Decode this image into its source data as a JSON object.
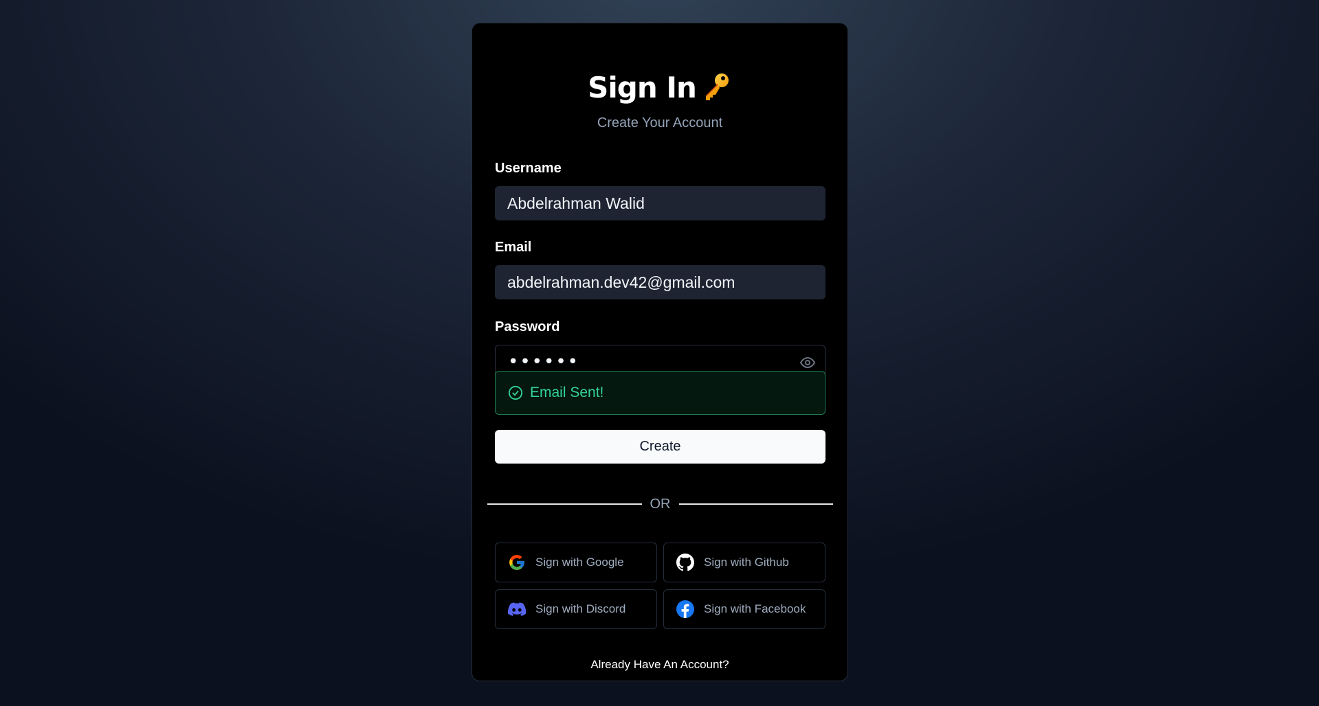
{
  "header": {
    "title": "Sign In",
    "subtitle": "Create Your Account"
  },
  "form": {
    "username": {
      "label": "Username",
      "value": "Abdelrahman Walid"
    },
    "email": {
      "label": "Email",
      "value": "abdelrahman.dev42@gmail.com"
    },
    "password": {
      "label": "Password",
      "masked_value": "••••••"
    },
    "alert": {
      "text": "Email Sent!",
      "status": "success",
      "color": "#34d399"
    },
    "submit_label": "Create"
  },
  "divider_label": "OR",
  "social": [
    {
      "label": "Sign with Google",
      "icon": "google-icon"
    },
    {
      "label": "Sign with Github",
      "icon": "github-icon"
    },
    {
      "label": "Sign with Discord",
      "icon": "discord-icon"
    },
    {
      "label": "Sign with Facebook",
      "icon": "facebook-icon"
    }
  ],
  "footer": {
    "link_text": "Already Have An Account?"
  },
  "colors": {
    "card_bg": "#000000",
    "input_bg": "#1e2431",
    "success": "#34d399",
    "button_bg": "#f8fafc"
  }
}
